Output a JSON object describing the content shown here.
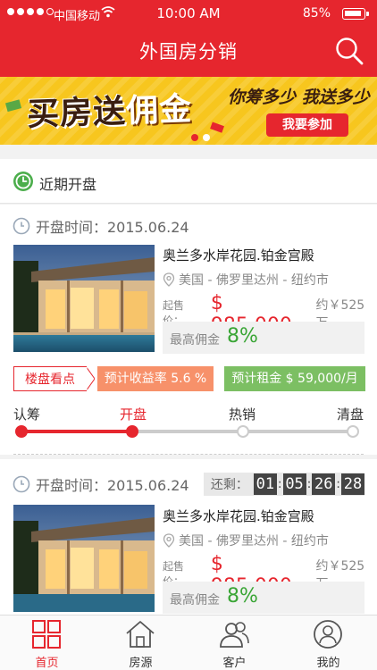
{
  "status_bar": {
    "carrier": "中国移动",
    "time": "10:00 AM",
    "battery": "85%"
  },
  "header": {
    "title": "外国房分销",
    "search_icon": "search-icon"
  },
  "banner": {
    "headline_a": "买房送",
    "headline_b": "佣金",
    "slogan": "你筹多少 我送多少",
    "cta": "我要参加",
    "active_slide": 1,
    "slide_count": 2
  },
  "section": {
    "title": "近期开盘",
    "icon": "clock-icon"
  },
  "listings": [
    {
      "open_date": "开盘时间：2015.06.24",
      "name": "奥兰多水岸花园.铂金宫殿",
      "location": "美国 - 佛罗里达州 - 纽约市",
      "price_label": "起售价：",
      "price": "$ 985,000",
      "price_approx": "约￥525万",
      "commission_label": "最高佣金",
      "commission": "8%",
      "tags": [
        "楼盘看点",
        "预计收益率 5.6 %",
        "预计租金 $ 59,000/月"
      ],
      "stages": [
        "认筹",
        "开盘",
        "热销",
        "清盘"
      ],
      "current_stage": 1
    },
    {
      "open_date": "开盘时间：2015.06.24",
      "countdown_label": "还剩：",
      "countdown": [
        "01",
        "05",
        "26",
        "28"
      ],
      "name": "奥兰多水岸花园.铂金宫殿",
      "location": "美国 - 佛罗里达州 - 纽约市",
      "price_label": "起售价：",
      "price": "$ 985,000",
      "price_approx": "约￥525万",
      "commission_label": "最高佣金",
      "commission": "8%"
    }
  ],
  "tabbar": {
    "items": [
      {
        "label": "首页",
        "icon": "home-grid-icon",
        "active": true
      },
      {
        "label": "房源",
        "icon": "house-icon",
        "active": false
      },
      {
        "label": "客户",
        "icon": "customers-icon",
        "active": false
      },
      {
        "label": "我的",
        "icon": "profile-icon",
        "active": false
      }
    ]
  },
  "colors": {
    "brand_red": "#e6262e",
    "commission_green": "#39a535",
    "rent_tag_green": "#7cbf63",
    "yield_tag_orange": "#f7916a",
    "banner_yellow": "#f7c61e"
  }
}
